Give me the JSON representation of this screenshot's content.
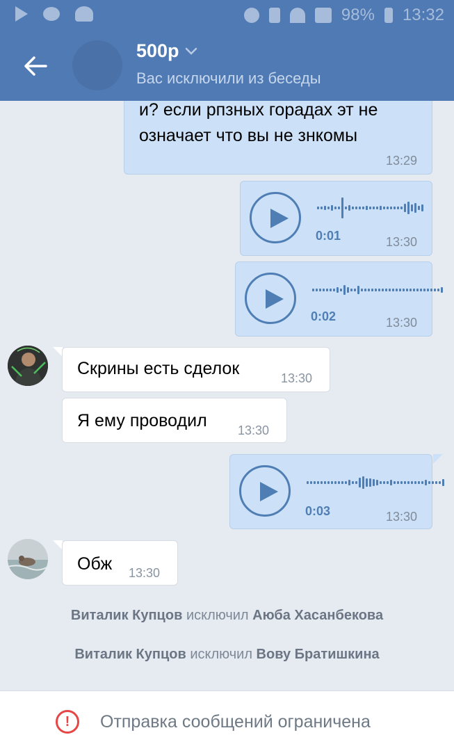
{
  "status_bar": {
    "battery": "98%",
    "time": "13:32",
    "icons": [
      "play-icon",
      "chat-icon",
      "add-friend-icon",
      "headphones-icon",
      "vibrate-icon",
      "wifi-icon",
      "signal-icon",
      "battery-icon"
    ]
  },
  "header": {
    "title": "500р",
    "subtitle": "Вас исключили из беседы",
    "back_icon": "back-arrow-icon",
    "dropdown_icon": "chevron-down-icon"
  },
  "messages": [
    {
      "type": "text",
      "direction": "out",
      "lines": [
        "и? если рпзных горадах эт не",
        "означает что вы не знкомы"
      ],
      "time": "13:29"
    },
    {
      "type": "voice",
      "direction": "out",
      "duration": "0:01",
      "time": "13:30"
    },
    {
      "type": "voice",
      "direction": "out",
      "duration": "0:02",
      "time": "13:30"
    },
    {
      "type": "text",
      "direction": "in",
      "text": "Скрины есть сделок",
      "time": "13:30"
    },
    {
      "type": "text",
      "direction": "in",
      "text": "Я ему проводил",
      "time": "13:30"
    },
    {
      "type": "voice",
      "direction": "out",
      "duration": "0:03",
      "time": "13:30"
    },
    {
      "type": "text",
      "direction": "in",
      "text": "Обж",
      "time": "13:30"
    }
  ],
  "system_messages": [
    {
      "actor": "Виталик Купцов",
      "action": "исключил",
      "target": "Аюба Хасанбекова"
    },
    {
      "actor": "Виталик Купцов",
      "action": "исключил",
      "target": "Вову Братишкина"
    }
  ],
  "bottom_bar": {
    "text": "Отправка сообщений ограничена",
    "icon": "warning-icon"
  },
  "colors": {
    "header_bg": "#507ab4",
    "outgoing_bubble": "#cce1f7",
    "incoming_bubble": "#ffffff",
    "background": "#e6ebf2",
    "accent": "#4f7eb4",
    "warning": "#e64646"
  }
}
